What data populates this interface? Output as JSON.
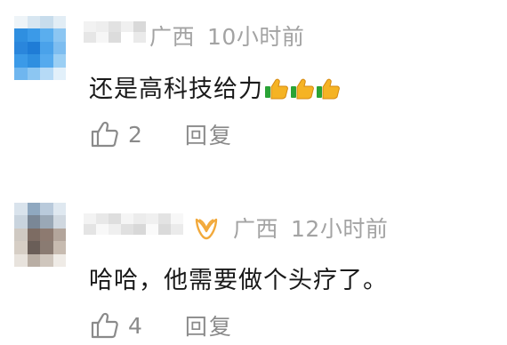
{
  "comments": [
    {
      "location": "广西",
      "time": "10小时前",
      "text": "还是高科技给力",
      "emoji": "thumbs-up-icon",
      "emoji_count": 3,
      "likes": "2",
      "reply_label": "回复"
    },
    {
      "location": "广西",
      "time": "12小时前",
      "text": "哈哈，他需要做个头疗了。",
      "badge": "vip-badge-icon",
      "likes": "4",
      "reply_label": "回复"
    }
  ],
  "colors": {
    "meta_text": "#a3a3a3",
    "body_text": "#1a1a1a",
    "action_text": "#8a8a8a",
    "badge": "#f2a93b"
  }
}
